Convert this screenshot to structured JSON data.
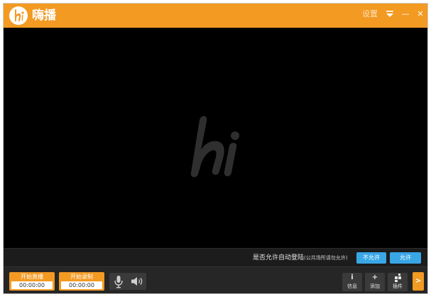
{
  "app": {
    "title": "嗨播",
    "logo_icon": "hi-logo-icon"
  },
  "titlebar": {
    "settings_label": "设置",
    "menu_icon": "triangle-down-icon",
    "minimize_glyph": "—",
    "close_glyph": "✕"
  },
  "preview": {
    "watermark_icon": "hi-watermark-icon"
  },
  "auto_login_prompt": {
    "question": "是否允许自动登陆",
    "hint": "(公共场所请勿允许)",
    "deny_label": "不允许",
    "allow_label": "允许"
  },
  "controls": {
    "live": {
      "label": "开始直播",
      "time": "00:00:00"
    },
    "record": {
      "label": "开始录制",
      "time": "00:00:00"
    },
    "mic_icon": "microphone-icon",
    "speaker_icon": "speaker-icon",
    "info": {
      "glyph": "i",
      "label": "信息"
    },
    "add": {
      "glyph": "+",
      "label": "添加"
    },
    "plugin": {
      "label": "插件"
    },
    "expand_glyph": ">"
  },
  "colors": {
    "accent": "#f39a22",
    "prompt_button": "#39a6e6",
    "preview_bg": "#000000"
  }
}
